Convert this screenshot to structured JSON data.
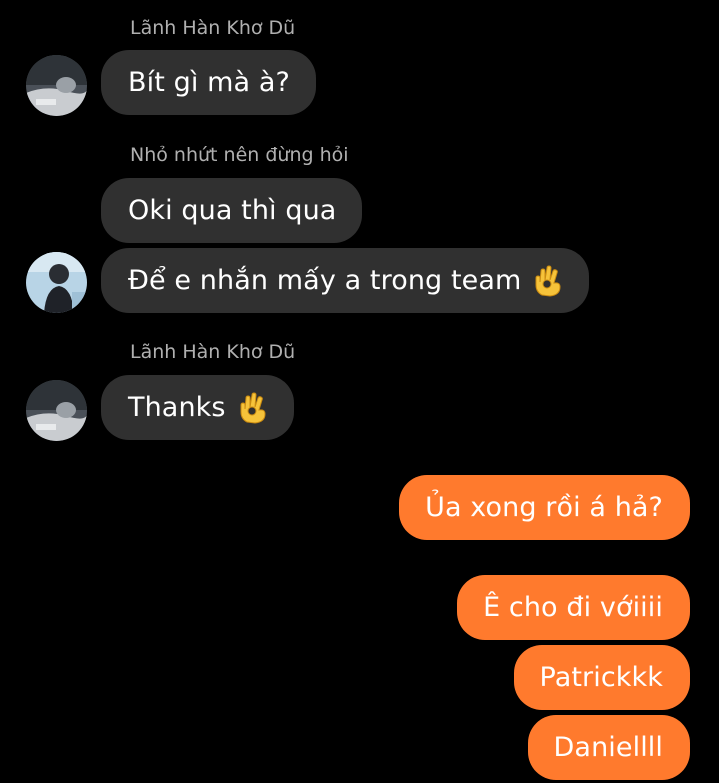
{
  "conversation": {
    "messages": [
      {
        "sender": "Lãnh Hàn Khơ Dũ",
        "text": "Bít gì mà à?",
        "direction": "incoming"
      },
      {
        "sender": "Nhỏ nhứt nên đừng hỏi",
        "text": "Oki qua thì qua",
        "direction": "incoming"
      },
      {
        "sender": "",
        "text": "Để e nhắn mấy a trong team",
        "emoji": "ok-hand-icon",
        "direction": "incoming"
      },
      {
        "sender": "Lãnh Hàn Khơ Dũ",
        "text": "Thanks",
        "emoji": "ok-hand-icon",
        "direction": "incoming"
      },
      {
        "sender": "",
        "text": "Ủa xong rồi á hả?",
        "direction": "outgoing"
      },
      {
        "sender": "",
        "text": "Ê cho đi vớiiii",
        "direction": "outgoing"
      },
      {
        "sender": "",
        "text": "Patrickkk",
        "direction": "outgoing"
      },
      {
        "sender": "",
        "text": "Daniellll",
        "direction": "outgoing"
      }
    ]
  },
  "colors": {
    "background": "#000000",
    "incoming_bubble": "#303030",
    "outgoing_bubble": "#ff7a2d",
    "sender_name": "#b0b0b0",
    "text": "#ffffff"
  }
}
